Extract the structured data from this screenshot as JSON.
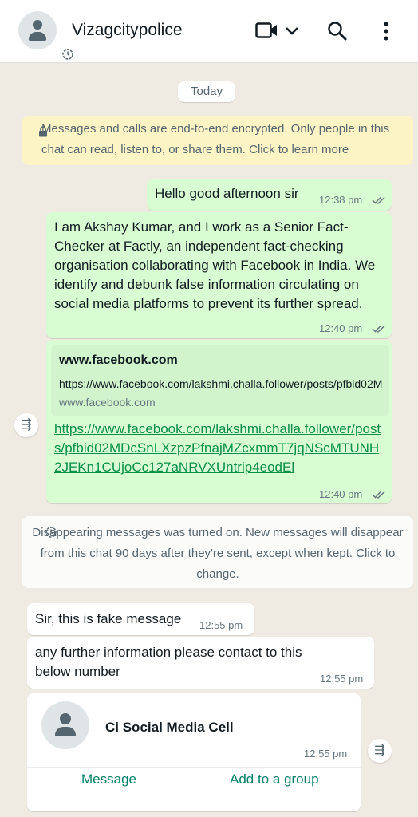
{
  "header": {
    "title": "Vizagcitypolice",
    "icons": [
      "contact-avatar",
      "disappearing-timer-icon",
      "video-call-icon",
      "chevron-down-icon",
      "search-icon",
      "more-vert-icon"
    ]
  },
  "chat": {
    "date_label": "Today",
    "encryption_notice": "Messages and calls are end-to-end encrypted. Only people in this chat can read, listen to, or share them. Click to learn more",
    "messages": [
      {
        "text": "Hello good afternoon sir",
        "time": "12:38 pm"
      },
      {
        "text": "I am Akshay Kumar, and I work as a Senior Fact-Checker at Factly, an independent fact-checking organisation collaborating with Facebook in India. We identify and debunk false information circulating on social media platforms to prevent its further spread.",
        "time": "12:40 pm"
      },
      {
        "preview_title": "www.facebook.com",
        "preview_url": "https://www.facebook.com/lakshmi.challa.follower/posts/pfbid02MDcSnLXzpzPfnajMZcxmmT7jqNScMTUNH2JEKn1CUjoCc127aNRVXUntrip4eodEl",
        "preview_domain": "www.facebook.com",
        "link": "https://www.facebook.com/lakshmi.challa.follower/posts/pfbid02MDcSnLXzpzPfnajMZcxmmT7jqNScMTUNH2JEKn1CUjoCc127aNRVXUntrip4eodEl",
        "time": "12:40 pm"
      }
    ],
    "disappearing_notice": "Disappearing messages was turned on. New messages will disappear from this chat 90 days after they're sent, except when kept. Click to change.",
    "incoming": [
      {
        "text": "Sir, this is fake message",
        "time": "12:55 pm"
      },
      {
        "text": "any further information please contact to this below number",
        "time": "12:55 pm"
      }
    ],
    "contact_card": {
      "name": "Ci Social Media Cell",
      "time": "12:55 pm",
      "message_button": "Message",
      "add_group_button": "Add to a group"
    }
  },
  "colors": {
    "outgoing_bubble": "#d9fdd3",
    "incoming_bubble": "#ffffff",
    "encryption_bg": "#fdf4c5",
    "link": "#068f46",
    "read_tick": "#667781",
    "accent": "#008069"
  }
}
